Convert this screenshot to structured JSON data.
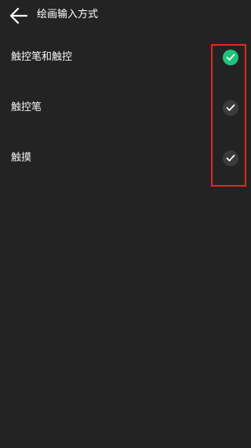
{
  "header": {
    "back_icon": "arrow-left-icon",
    "title": "绘画输入方式"
  },
  "options": [
    {
      "label": "触控笔和触控",
      "selected": true
    },
    {
      "label": "触控笔",
      "selected": false
    },
    {
      "label": "触摸",
      "selected": false
    }
  ],
  "colors": {
    "background": "#232323",
    "accent": "#1fc27a",
    "unselected_check": "#3b3b3b",
    "annotation_box": "#e02a1d"
  }
}
